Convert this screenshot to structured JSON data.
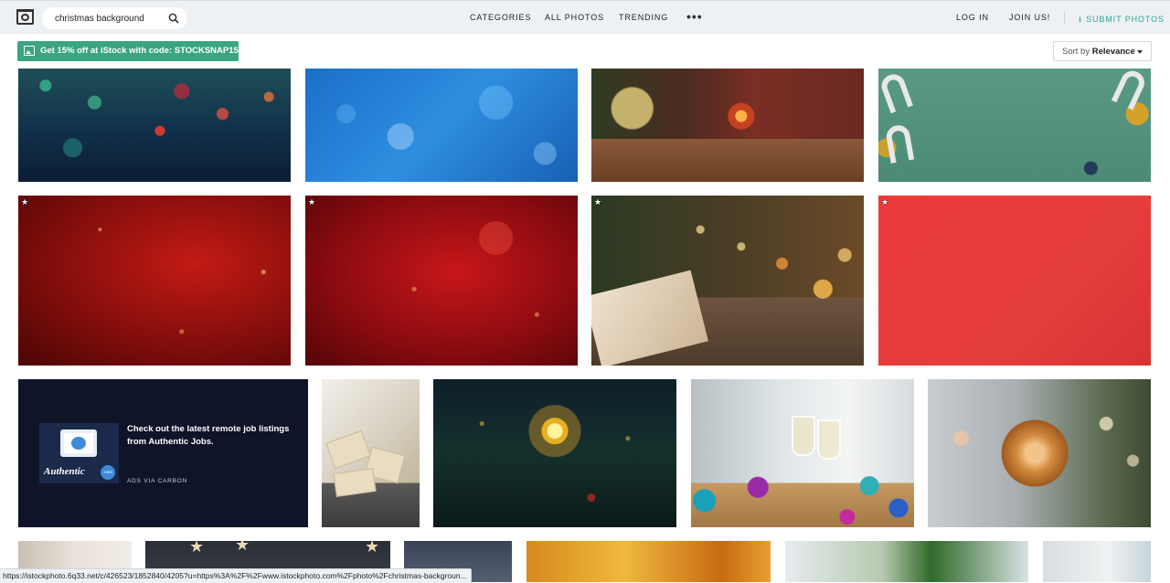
{
  "header": {
    "search_value": "christmas background",
    "nav": [
      "CATEGORIES",
      "ALL PHOTOS",
      "TRENDING"
    ],
    "more_label": "•••",
    "login": "LOG IN",
    "join": "JOIN US!",
    "submit": "SUBMIT PHOTOS",
    "accent_color": "#2aa39a"
  },
  "promo": {
    "text": "Get 15% off at iStock with code: STOCKSNAP15 →",
    "icon": "image-icon",
    "color": "#3aa57f"
  },
  "sort": {
    "prefix": "Sort by",
    "value": "Relevance"
  },
  "ad": {
    "headline": "Check out the latest remote job listings from Authentic Jobs.",
    "via": "ADS VIA CARBON",
    "logo_text": "Authentic",
    "badge_text": "JOBS"
  },
  "photos": {
    "premium_star": "★"
  },
  "status_url": "https://istockphoto.6q33.net/c/426523/1852840/4205?u=https%3A%2F%2Fwww.istockphoto.com%2Fphoto%2Fchristmas-backgroun..."
}
